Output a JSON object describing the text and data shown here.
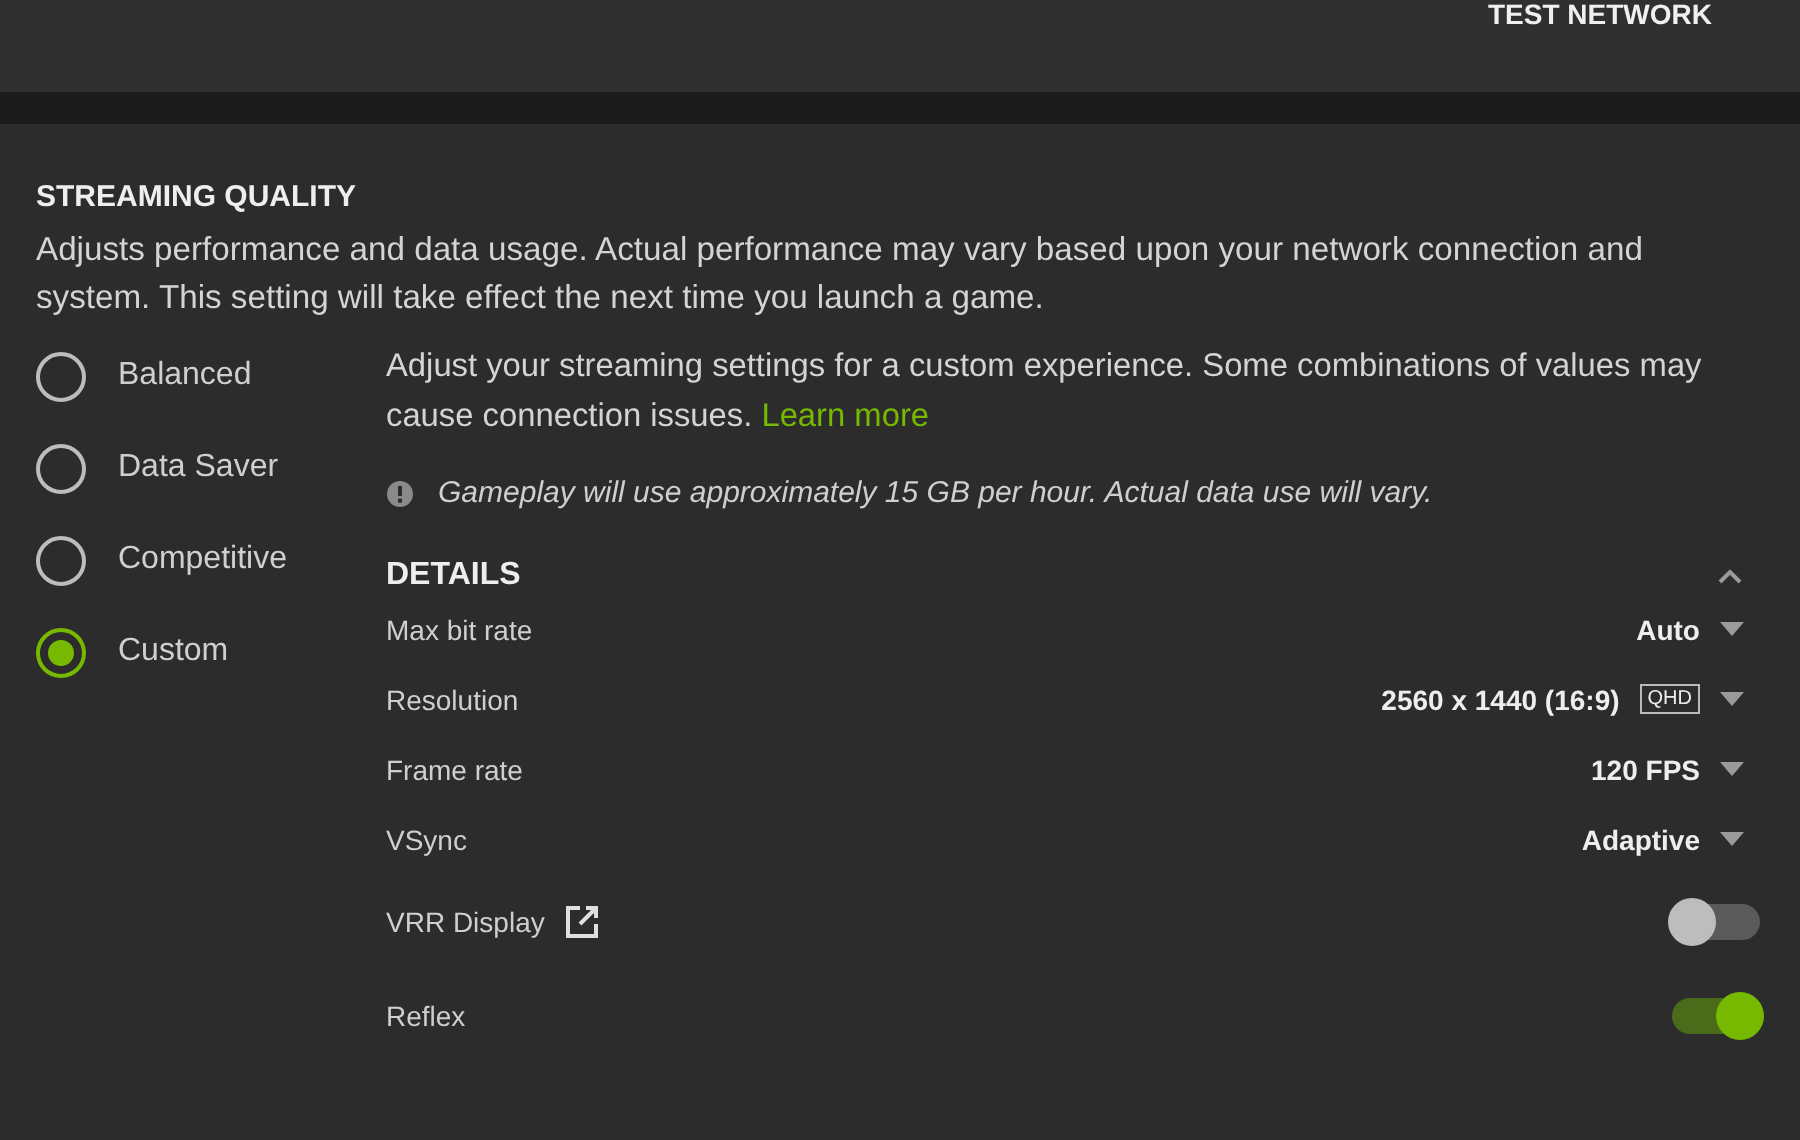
{
  "header": {
    "button": "TEST NETWORK"
  },
  "section": {
    "title": "STREAMING QUALITY",
    "description": "Adjusts performance and data usage. Actual performance may vary based upon your network connection and system. This setting will take effect the next time you launch a game."
  },
  "presets": [
    {
      "label": "Balanced",
      "selected": false
    },
    {
      "label": "Data Saver",
      "selected": false
    },
    {
      "label": "Competitive",
      "selected": false
    },
    {
      "label": "Custom",
      "selected": true
    }
  ],
  "custom": {
    "intro": "Adjust your streaming settings for a custom experience. Some combinations of values may cause connection issues.",
    "link": "Learn more",
    "notice": "Gameplay will use approximately 15 GB per hour. Actual data use will vary."
  },
  "details": {
    "title": "DETAILS",
    "expanded": true,
    "rows": [
      {
        "kind": "dropdown",
        "label": "Max bit rate",
        "value": "Auto"
      },
      {
        "kind": "dropdown",
        "label": "Resolution",
        "value": "2560 x 1440 (16:9)",
        "badge": "QHD"
      },
      {
        "kind": "dropdown",
        "label": "Frame rate",
        "value": "120 FPS"
      },
      {
        "kind": "dropdown",
        "label": "VSync",
        "value": "Adaptive"
      },
      {
        "kind": "toggle",
        "label": "VRR Display",
        "external_link": true,
        "on": false
      },
      {
        "kind": "toggle",
        "label": "Reflex",
        "on": true
      }
    ]
  }
}
